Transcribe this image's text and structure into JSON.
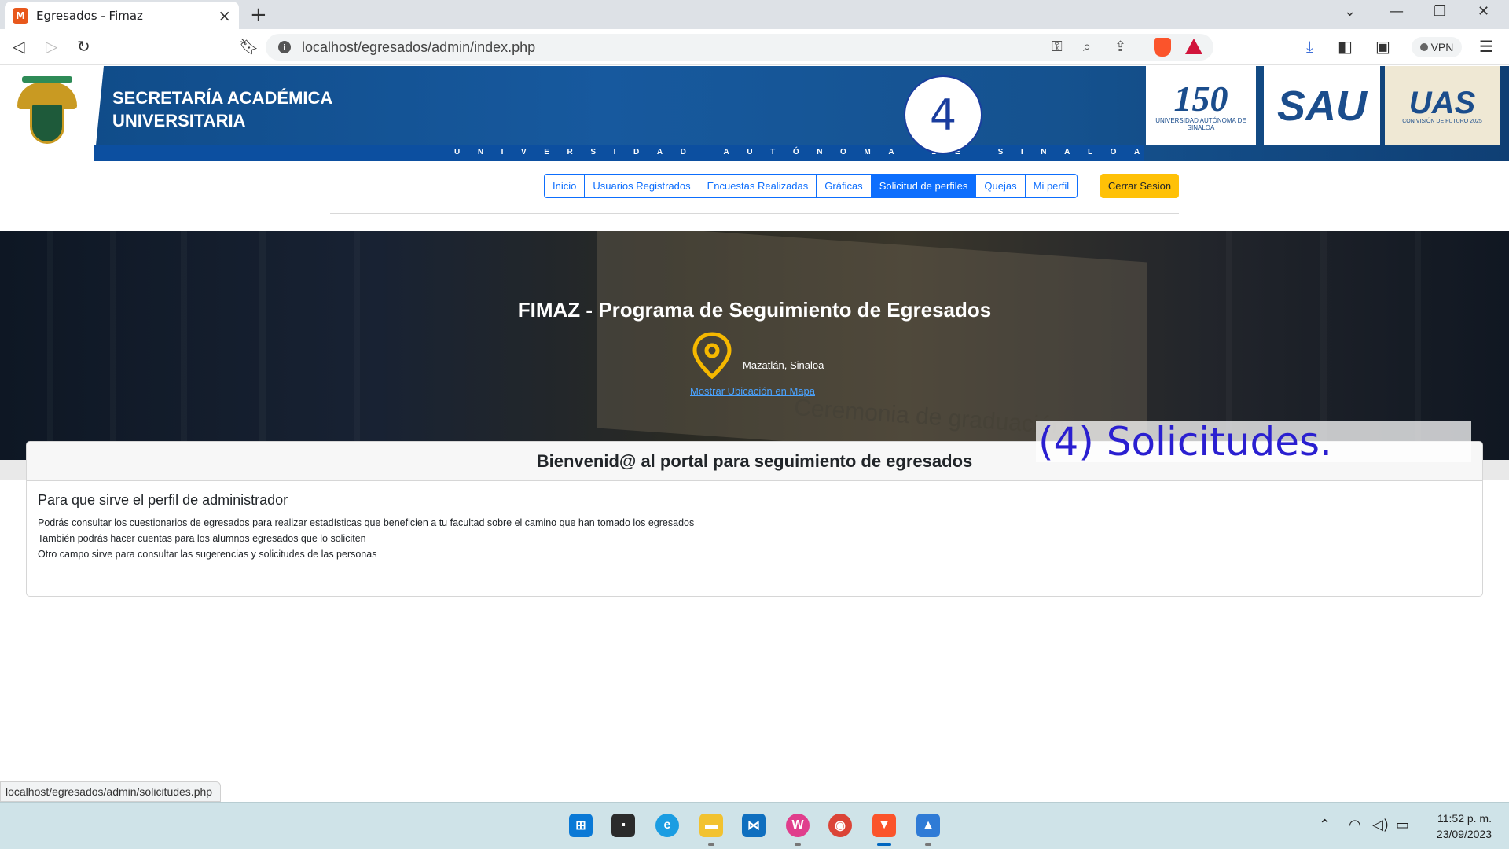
{
  "browser": {
    "tab_title": "Egresados - Fimaz",
    "tab_favicon_letter": "M",
    "url": "localhost/egresados/admin/index.php",
    "vpn_label": "VPN",
    "status_url": "localhost/egresados/admin/solicitudes.php"
  },
  "banner": {
    "title_line1": "SECRETARÍA ACADÉMICA",
    "title_line2": "UNIVERSITARIA",
    "university_strip": "UNIVERSIDAD AUTÓNOMA DE SINALOA",
    "step_number": "4",
    "logo150_big": "150",
    "logo150_small": "UNIVERSIDAD AUTÓNOMA DE SINALOA",
    "logo_sau": "SAU",
    "logo_uas": "UAS",
    "logo_uas_small": "CON VISIÓN DE FUTURO 2025"
  },
  "nav": {
    "items": [
      {
        "label": "Inicio",
        "active": false
      },
      {
        "label": "Usuarios Registrados",
        "active": false
      },
      {
        "label": "Encuestas Realizadas",
        "active": false
      },
      {
        "label": "Gráficas",
        "active": false
      },
      {
        "label": "Solicitud de perfiles",
        "active": true
      },
      {
        "label": "Quejas",
        "active": false
      },
      {
        "label": "Mi perfil",
        "active": false
      }
    ],
    "logout_label": "Cerrar Sesion"
  },
  "hero": {
    "title": "FIMAZ - Programa de Seguimiento de Egresados",
    "city": "Mazatlán, Sinaloa",
    "map_link": "Mostrar Ubicación en Mapa",
    "background_sign_text": "Ceremonia de graduación"
  },
  "card": {
    "header": "Bienvenid@ al portal para seguimiento de egresados",
    "subtitle": "Para que sirve el perfil de administrador",
    "lines": [
      "Podrás consultar los cuestionarios de egresados para realizar estadísticas que beneficien a tu facultad sobre el camino que han tomado los egresados",
      "También podrás hacer cuentas para los alumnos egresados que lo soliciten",
      "Otro campo sirve para consultar las sugerencias y solicitudes de las personas"
    ]
  },
  "annotation": "(4) Solicitudes.",
  "taskbar": {
    "time": "11:52 p. m.",
    "date": "23/09/2023"
  },
  "colors": {
    "banner_blue": "#17599e",
    "nav_primary": "#0d6efd",
    "logout_yellow": "#ffc107",
    "pin_yellow": "#f5b800",
    "annotation_blue": "#2a1fd0"
  }
}
